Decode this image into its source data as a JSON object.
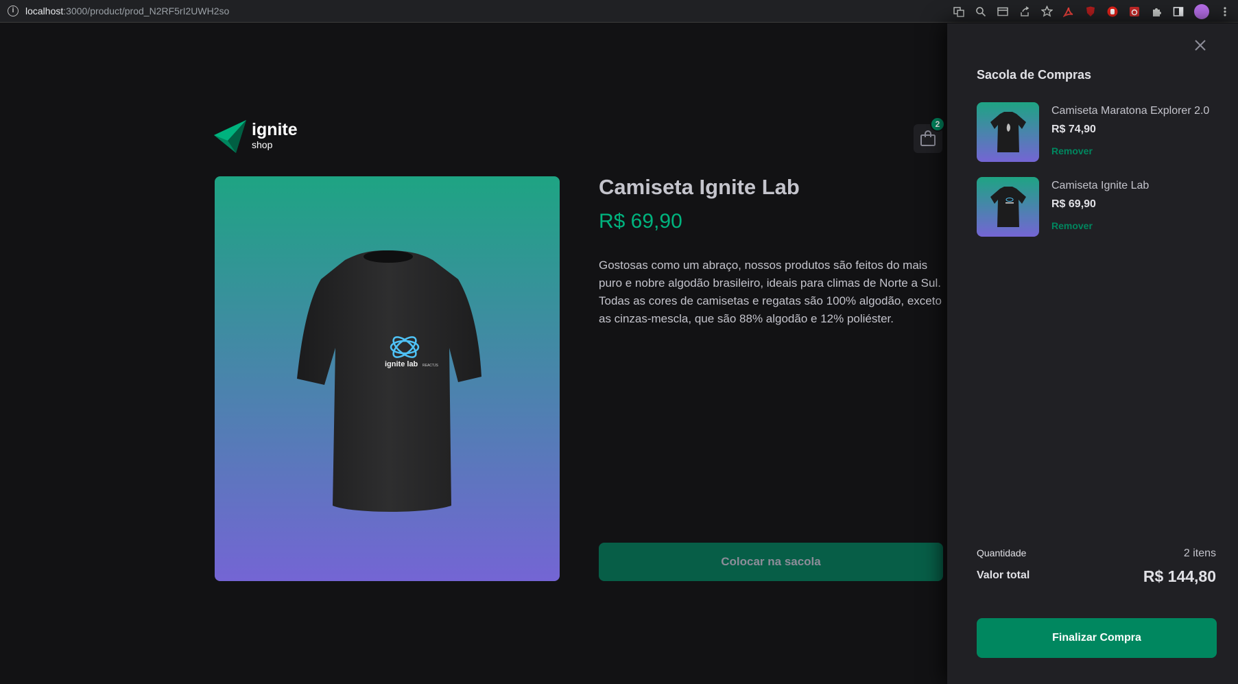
{
  "browser": {
    "url_host": "localhost",
    "url_path": ":3000/product/prod_N2RF5rI2UWH2so"
  },
  "logo": {
    "title": "ignite",
    "subtitle": "shop"
  },
  "header": {
    "bag_count": "2"
  },
  "product": {
    "title": "Camiseta Ignite Lab",
    "price": "R$ 69,90",
    "description": "Gostosas como um abraço, nossos produtos são feitos do mais puro e nobre algodão brasileiro, ideais para climas de Norte a Sul. Todas as cores de camisetas e regatas são 100% algodão, exceto as cinzas-mescla, que são 88% algodão e 12% poliéster.",
    "add_button": "Colocar na sacola",
    "image_text": "ignite lab",
    "image_subtext": "REACTJS"
  },
  "cart": {
    "title": "Sacola de Compras",
    "items": [
      {
        "name": "Camiseta Maratona Explorer 2.0",
        "price": "R$ 74,90",
        "remove": "Remover"
      },
      {
        "name": "Camiseta Ignite Lab",
        "price": "R$ 69,90",
        "remove": "Remover"
      }
    ],
    "quantity_label": "Quantidade",
    "quantity_value": "2 itens",
    "total_label": "Valor total",
    "total_value": "R$ 144,80",
    "checkout_button": "Finalizar Compra"
  },
  "colors": {
    "accent": "#00875f",
    "accent_light": "#00b37e",
    "background": "#121214",
    "drawer": "#202024"
  }
}
